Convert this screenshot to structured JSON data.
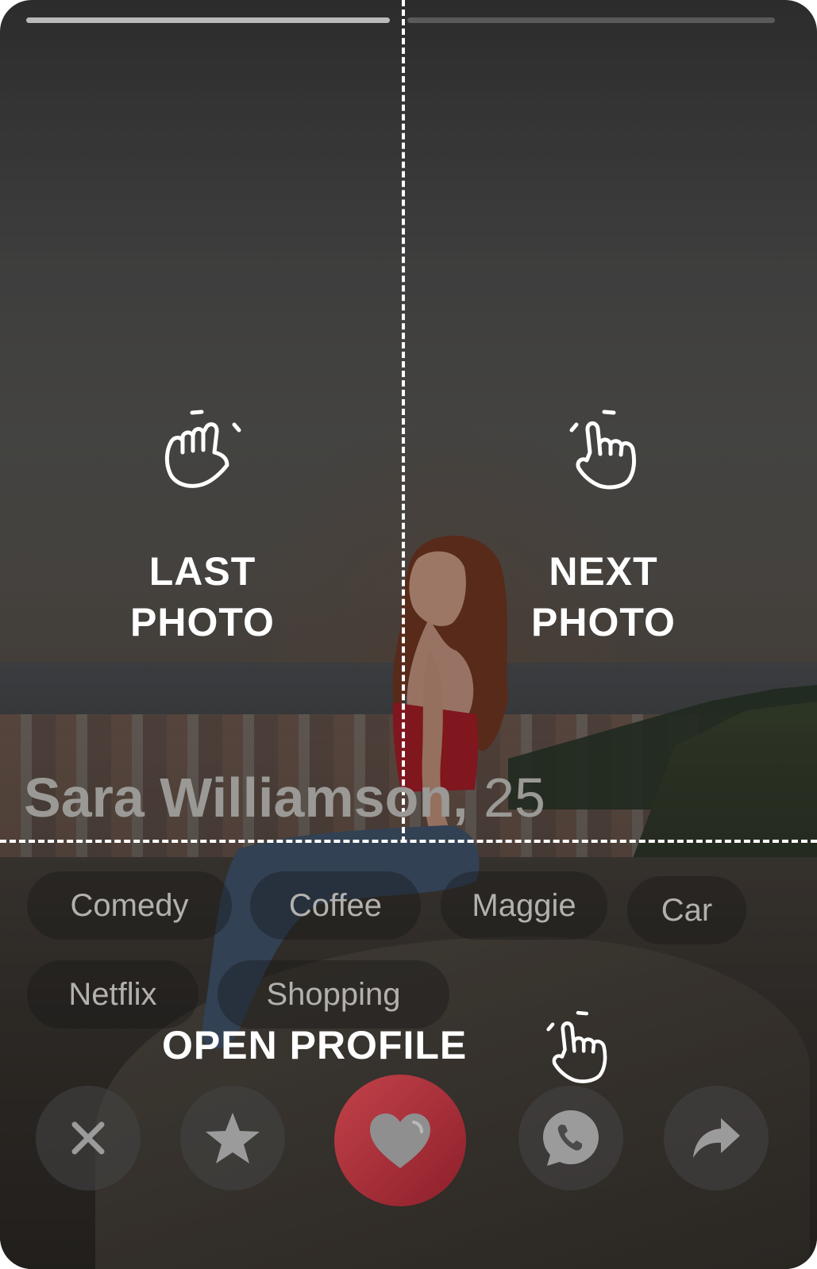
{
  "profile": {
    "name": "Sara Williamson,",
    "age": "25",
    "interests": [
      "Comedy",
      "Coffee",
      "Maggie",
      "Car",
      "Netflix",
      "Shopping"
    ]
  },
  "photo_progress": {
    "current": 1,
    "total": 2
  },
  "tap_zones": {
    "left": {
      "line1": "LAST",
      "line2": "PHOTO",
      "icon": "tap-hand-icon"
    },
    "right": {
      "line1": "NEXT",
      "line2": "PHOTO",
      "icon": "tap-hand-icon"
    },
    "bottom": {
      "label": "OPEN PROFILE",
      "icon": "tap-hand-icon"
    }
  },
  "actions": [
    {
      "name": "dislike",
      "icon": "close-icon"
    },
    {
      "name": "superlike",
      "icon": "star-icon"
    },
    {
      "name": "like",
      "icon": "heart-icon",
      "color": "#b8323d"
    },
    {
      "name": "call",
      "icon": "phone-chat-icon"
    },
    {
      "name": "share",
      "icon": "share-arrow-icon"
    }
  ]
}
